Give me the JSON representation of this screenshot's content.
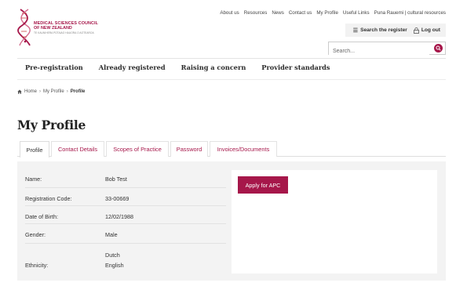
{
  "brand": {
    "line1": "MEDICAL SCIENCES COUNCIL",
    "line2": "OF NEW ZEALAND",
    "line3": "TE KAUNIHERA PŪTAIAO HAUORA O AOTEAROA",
    "color": "#a6174a"
  },
  "toplinks": [
    "About us",
    "Resources",
    "News",
    "Contact us",
    "My Profile",
    "Useful Links",
    "Puna Rauemi | cultural resources"
  ],
  "actions": {
    "search_register": "Search the register",
    "logout": "Log out"
  },
  "search": {
    "placeholder": "Search..."
  },
  "mainnav": [
    "Pre-registration",
    "Already registered",
    "Raising a concern",
    "Provider standards"
  ],
  "breadcrumb": {
    "home": "Home",
    "parent": "My Profile",
    "current": "Profile"
  },
  "page_title": "My Profile",
  "tabs": [
    "Profile",
    "Contact Details",
    "Scopes of Practice",
    "Password",
    "Invoices/Documents"
  ],
  "active_tab": "Profile",
  "profile": {
    "name_label": "Name:",
    "name": "Bob Test",
    "reg_label": "Registration Code:",
    "reg": "33-00669",
    "dob_label": "Date of Birth:",
    "dob": "12/02/1988",
    "gender_label": "Gender:",
    "gender": "Male",
    "ethnicity_label": "Ethnicity:",
    "ethnicity": [
      "Dutch",
      "English"
    ]
  },
  "apc_button": "Apply for APC"
}
